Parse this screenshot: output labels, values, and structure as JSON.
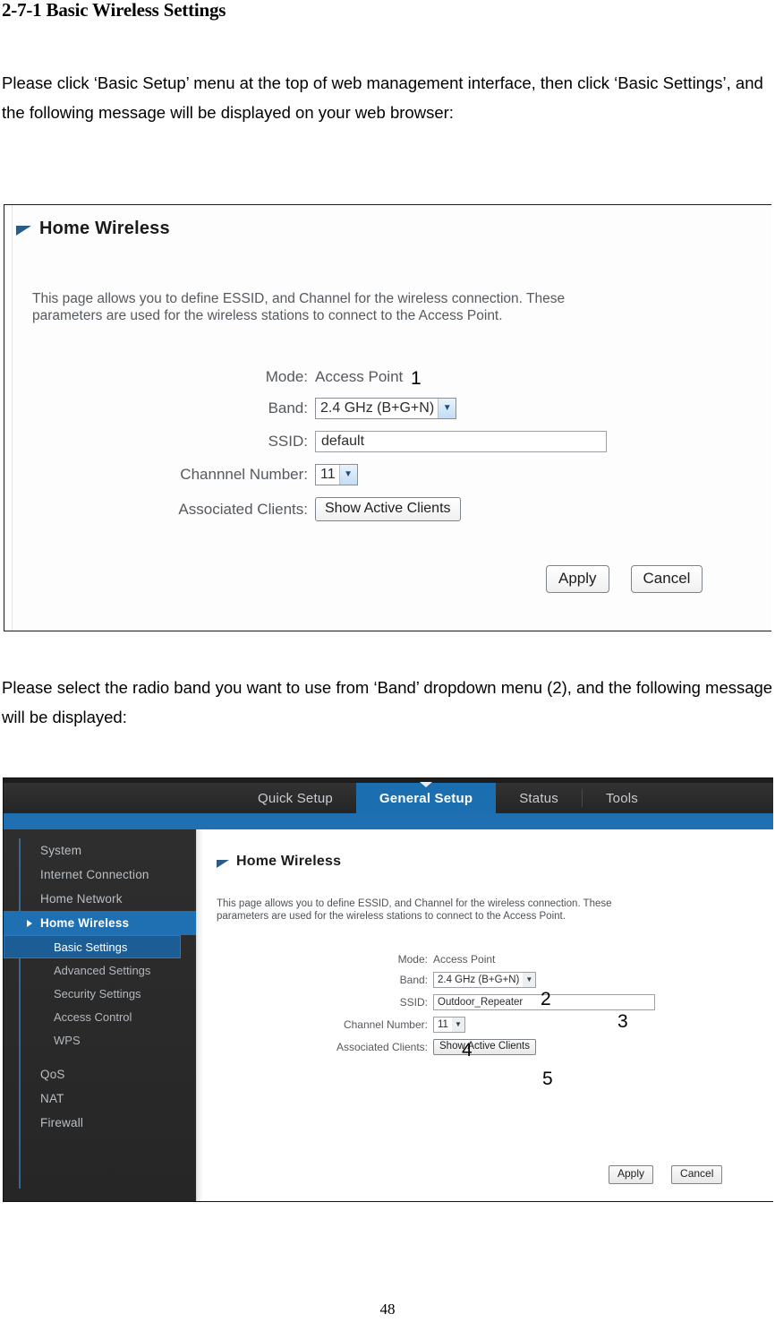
{
  "document": {
    "heading": "2-7-1 Basic Wireless Settings",
    "paragraph_1": "Please click ‘Basic Setup’ menu at the top of web management interface, then click ‘Basic Settings’, and the following message will be displayed on your web browser:",
    "paragraph_2": "Please select the radio band you want to use from ‘Band’ dropdown menu (2), and the following message will be displayed:",
    "page_number": "48"
  },
  "screenshot_1": {
    "panel_title": "Home Wireless",
    "panel_description": "This page allows you to define ESSID, and Channel for the wireless connection. These\nparameters are used for the wireless stations to connect to the Access Point.",
    "fields": {
      "mode_label": "Mode:",
      "mode_value": "Access Point",
      "band_label": "Band:",
      "band_value": "2.4 GHz (B+G+N)",
      "ssid_label": "SSID:",
      "ssid_value": "default",
      "channel_label": "Channnel Number:",
      "channel_value": "11",
      "clients_label": "Associated Clients:",
      "clients_button": "Show Active Clients"
    },
    "buttons": {
      "apply": "Apply",
      "cancel": "Cancel"
    },
    "callouts": {
      "one": "1"
    }
  },
  "screenshot_2": {
    "nav_tabs": [
      {
        "label": "Quick Setup",
        "active": false
      },
      {
        "label": "General Setup",
        "active": true
      },
      {
        "label": "Status",
        "active": false
      },
      {
        "label": "Tools",
        "active": false
      }
    ],
    "sidebar": {
      "items": [
        {
          "label": "System"
        },
        {
          "label": "Internet Connection"
        },
        {
          "label": "Home Network"
        },
        {
          "label": "Home Wireless"
        }
      ],
      "sub_items": [
        {
          "label": "Basic Settings"
        },
        {
          "label": "Advanced Settings"
        },
        {
          "label": "Security Settings"
        },
        {
          "label": "Access Control"
        },
        {
          "label": "WPS"
        }
      ],
      "trailing_items": [
        {
          "label": "QoS"
        },
        {
          "label": "NAT"
        },
        {
          "label": "Firewall"
        }
      ]
    },
    "panel_title": "Home Wireless",
    "panel_description": "This page allows you to define ESSID, and Channel for the wireless connection. These\nparameters are used for the wireless stations to connect to the Access Point.",
    "fields": {
      "mode_label": "Mode:",
      "mode_value": "Access Point",
      "band_label": "Band:",
      "band_value": "2.4 GHz (B+G+N)",
      "ssid_label": "SSID:",
      "ssid_value": "Outdoor_Repeater",
      "channel_label": "Channel Number:",
      "channel_value": "11",
      "clients_label": "Associated Clients:",
      "clients_button": "Show Active Clients"
    },
    "buttons": {
      "apply": "Apply",
      "cancel": "Cancel"
    },
    "callouts": {
      "two": "2",
      "three": "3",
      "four": "4",
      "five": "5"
    }
  },
  "colors": {
    "accent_blue": "#1f6fb3",
    "sidebar_dark": "#2a2a2a",
    "topbar_dark": "#2b2b2b",
    "sub_selected_blue": "#1d5d96",
    "panel_icon_blue": "#2b5c86"
  }
}
